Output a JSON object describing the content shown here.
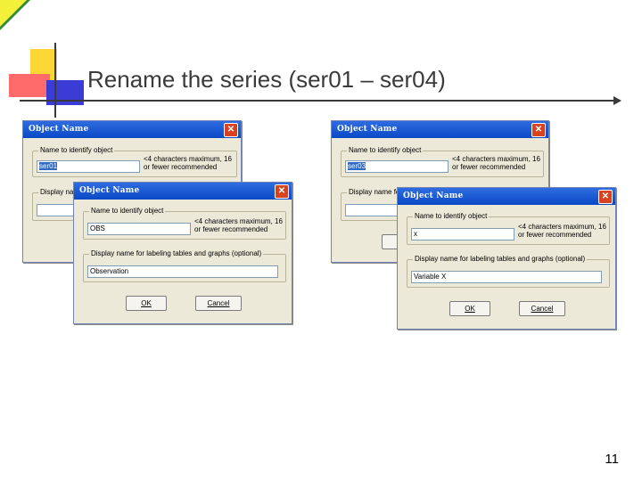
{
  "slide": {
    "title": "Rename the series (ser01 – ser04)",
    "page_number": "11"
  },
  "dialogs": [
    {
      "title": "Object Name",
      "name_legend": "Name to identify object",
      "name_value": "ser01",
      "hint": "<4 characters maximum, 16 or fewer recommended",
      "display_legend": "Display name for",
      "display_value": ""
    },
    {
      "title": "Object Name",
      "name_legend": "Name to identify object",
      "name_value": "OBS",
      "hint": "<4 characters maximum, 16 or fewer recommended",
      "display_legend": "Display name for labeling tables and graphs (optional)",
      "display_value": "Observation",
      "ok_label": "OK",
      "cancel_label": "Cancel"
    },
    {
      "title": "Object Name",
      "name_legend": "Name to identify object",
      "name_value": "ser03",
      "hint": "<4 characters maximum, 16 or fewer recommended",
      "display_legend": "Display name fo",
      "display_value": ""
    },
    {
      "title": "Object Name",
      "name_legend": "Name to identify object",
      "name_value": "x",
      "hint": "<4 characters maximum, 16 or fewer recommended",
      "display_legend": "Display name for labeling tables and graphs (optional)",
      "display_value": "Variable X",
      "ok_label": "OK",
      "cancel_label": "Cancel"
    }
  ]
}
